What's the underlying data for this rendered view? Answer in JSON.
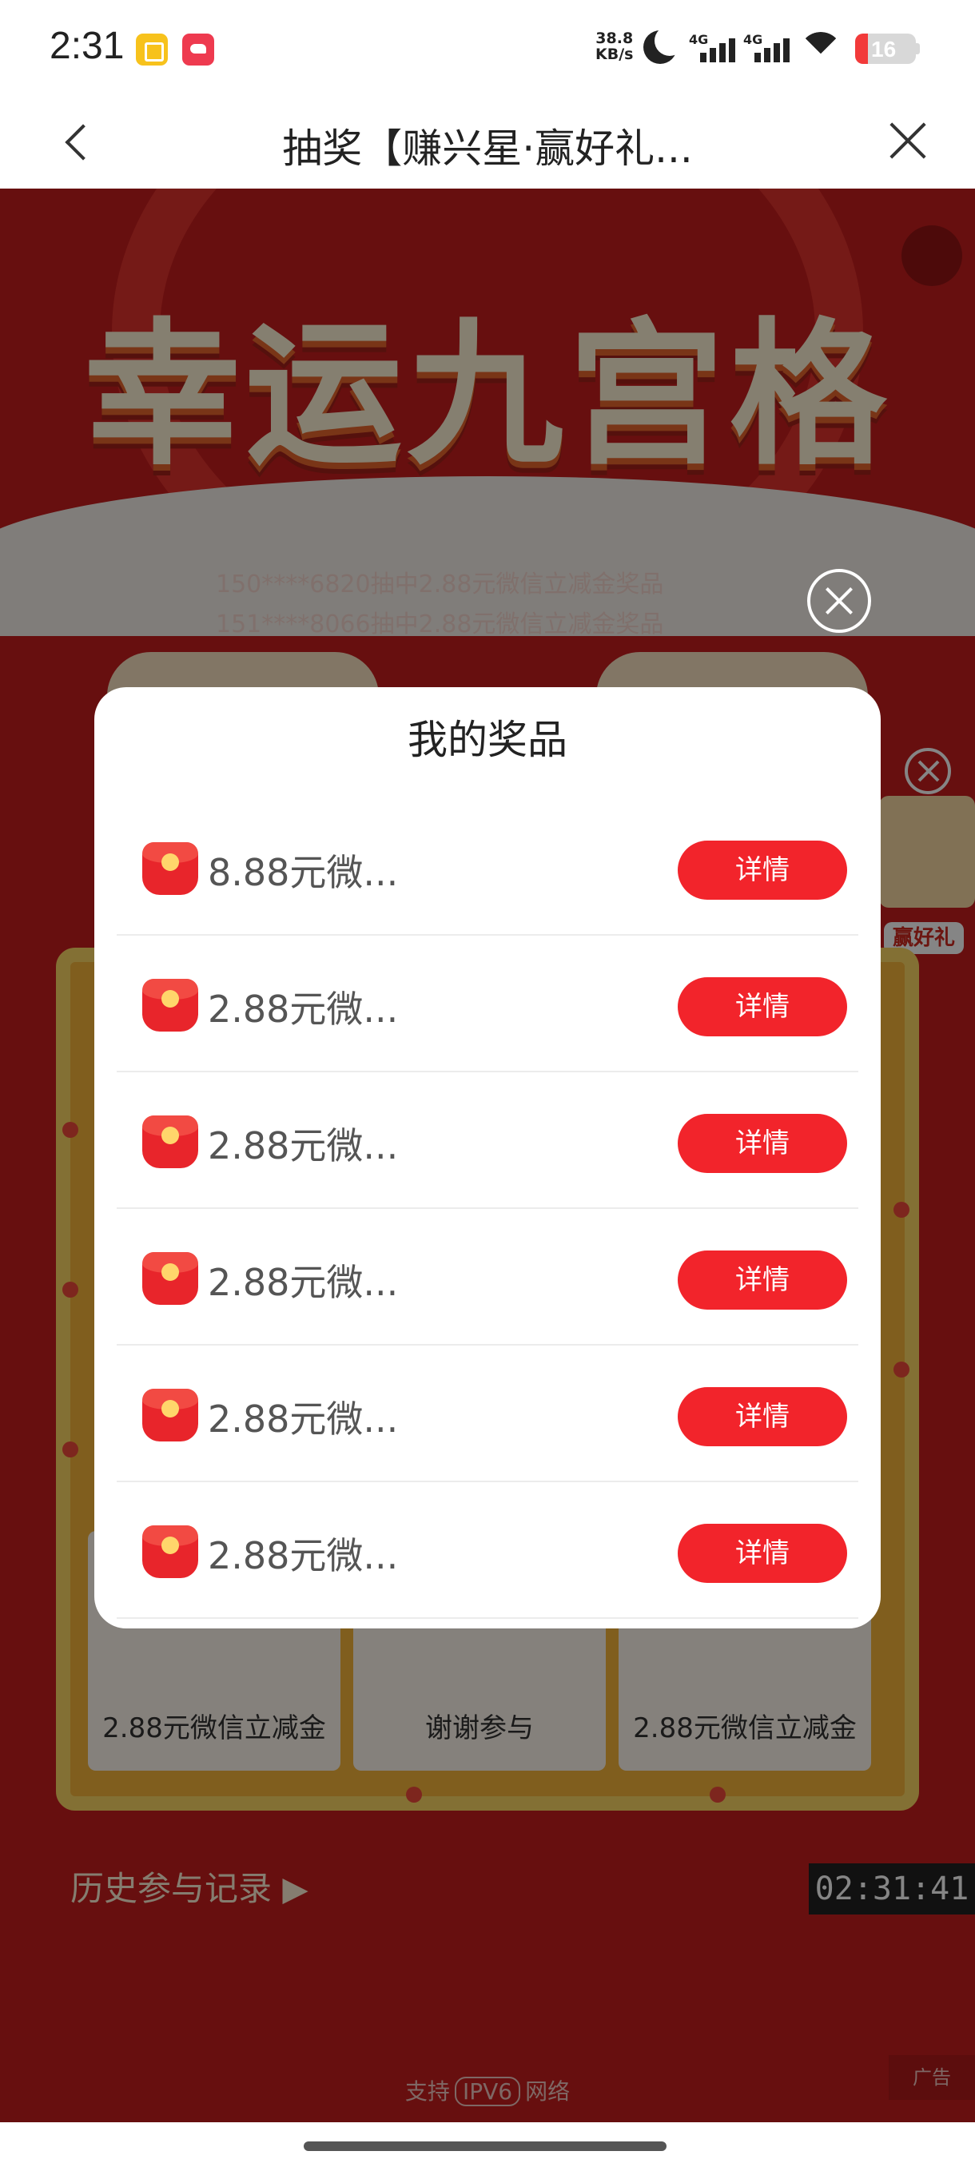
{
  "status_bar": {
    "time": "2:31",
    "net_speed_value": "38.8",
    "net_speed_unit": "KB/s",
    "signal1_label": "4G",
    "signal2_label": "4G",
    "battery": "16",
    "battery_color": "#f23a3a"
  },
  "nav": {
    "back_icon": "chevron-left",
    "title": "抽奖【赚兴星·赢好礼...",
    "close_icon": "close"
  },
  "background_page": {
    "banner_title": "幸运九宫格",
    "ticker": [
      "150****6820抽中2.88元微信立减金奖品",
      "151****8066抽中2.88元微信立减金奖品"
    ],
    "side_ad_label": "赢好礼",
    "grid_cells": [
      "2.88元微信立减金",
      "谢谢参与",
      "2.88元微信立减金"
    ],
    "history_link": "历史参与记录 ▶",
    "clock": "02:31:41",
    "ipv6_prefix": "支持",
    "ipv6_box": "IPV6",
    "ipv6_suffix": "网络",
    "ad_label": "广告",
    "bg_color": "#c61d1d"
  },
  "modal": {
    "title": "我的奖品",
    "accent": "#f2242b",
    "prizes": [
      {
        "name": "8.88元微...",
        "button": "详情"
      },
      {
        "name": "2.88元微...",
        "button": "详情"
      },
      {
        "name": "2.88元微...",
        "button": "详情"
      },
      {
        "name": "2.88元微...",
        "button": "详情"
      },
      {
        "name": "2.88元微...",
        "button": "详情"
      },
      {
        "name": "2.88元微...",
        "button": "详情"
      }
    ]
  }
}
